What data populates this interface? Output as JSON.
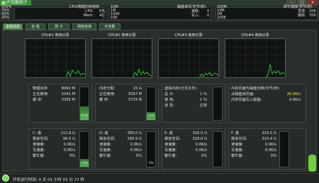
{
  "window": {
    "title": "IP流量统计",
    "buttons": [
      "–",
      "□",
      "×"
    ]
  },
  "top_meters": {
    "left_scale": [
      "100%",
      "75%",
      "50%",
      "25%",
      "0%"
    ],
    "cpu": {
      "title": "CPU/物理内存使用",
      "cpu_label": "CPU:",
      "cpu_value": "0%",
      "mem_label": "Mem:",
      "mem_value": "41"
    },
    "disk": {
      "scale": [
        "10M",
        "1M",
        "100K",
        "10K",
        "1K"
      ],
      "title": "磁盘读写(字节/秒)",
      "read_label": "读取:",
      "read_value": "0",
      "write_label": "写入:",
      "write_value": "0"
    },
    "net": {
      "scale": [
        "100M",
        "10M",
        "1M",
        "100K"
      ],
      "title": "网卡速度(字节/秒)",
      "send_label": "发送:",
      "send_value": "106",
      "recv_label": "接收:",
      "recv_value": "700"
    }
  },
  "tabs": [
    "系统状态",
    "进 程",
    "网 卡",
    "网络连接",
    "IP流量"
  ],
  "cpu_charts": [
    {
      "title": "CPU#1 使用记录",
      "values": [
        0,
        0,
        0,
        0,
        0,
        0,
        0,
        0,
        0,
        0,
        0,
        0,
        0,
        0,
        0,
        0,
        0,
        0,
        0,
        1,
        3,
        18,
        6,
        22,
        15,
        13,
        20,
        9,
        14,
        12,
        10
      ]
    },
    {
      "title": "CPU#2 使用记录",
      "values": [
        0,
        0,
        0,
        0,
        0,
        0,
        0,
        0,
        0,
        0,
        0,
        0,
        0,
        0,
        0,
        0,
        0,
        0,
        0,
        1,
        2,
        16,
        8,
        24,
        11,
        18,
        12,
        16,
        10,
        8,
        6
      ]
    },
    {
      "title": "CPU#3 使用记录",
      "values": [
        0,
        0,
        0,
        0,
        0,
        0,
        0,
        0,
        0,
        0,
        0,
        0,
        0,
        0,
        0,
        0,
        0,
        0,
        0,
        1,
        2,
        12,
        5,
        14,
        10,
        16,
        8,
        12,
        14,
        9,
        7
      ]
    },
    {
      "title": "CPU#4 使用记录",
      "values": [
        0,
        0,
        0,
        0,
        0,
        0,
        0,
        0,
        0,
        0,
        0,
        0,
        0,
        0,
        0,
        0,
        0,
        0,
        0,
        1,
        4,
        10,
        36,
        12,
        18,
        14,
        20,
        11,
        16,
        13,
        10
      ]
    }
  ],
  "memory": {
    "physical": {
      "rows": [
        [
          "物理内存:",
          "8060 M"
        ],
        [
          "正在使用:",
          "3341 M"
        ],
        [
          "缓 存:",
          "3356 M"
        ]
      ],
      "percent": 41,
      "percent_label": "41%"
    },
    "commit": {
      "rows": [
        [
          "内存分配:",
          "15 G"
        ],
        [
          "正在使用:",
          "3597 M"
        ],
        [
          "缓 存:",
          "3734 M"
        ]
      ],
      "percent": 23,
      "percent_label": "23%"
    },
    "virtual": {
      "rows": [
        [
          "虚拟内存(分页文件):",
          ""
        ],
        [
          "总 计:",
          "1 %"
        ],
        [
          "使 用:",
          "1 %"
        ],
        [
          "状 态:",
          "正常"
        ]
      ],
      "percent": 1,
      "percent_label": ""
    },
    "paging": {
      "rows": [
        [
          "内存页面与磁盘交换(字节/秒)",
          ""
        ],
        [
          "从磁盘读页面:",
          "26.0K/s"
        ],
        [
          "内存页面写入磁盘:",
          "0.0K/s"
        ]
      ]
    }
  },
  "disks": [
    {
      "name": "C: 盘",
      "total": "111.8 G",
      "rows": [
        [
          "剩余空间:",
          "96.0 G"
        ],
        [
          "读速度:",
          "0.0K/s"
        ],
        [
          "写速度:",
          "0.0K/s"
        ],
        [
          "繁忙度:",
          "0%"
        ]
      ],
      "percent": 23,
      "percent_label": "23%"
    },
    {
      "name": "D: 盘",
      "total": "300.0 G",
      "rows": [
        [
          "剩余空间:",
          "295.9 G"
        ],
        [
          "读速度:",
          "0.0K/s"
        ],
        [
          "写速度:",
          "0.0K/s"
        ],
        [
          "繁忙度:",
          "0%"
        ]
      ],
      "percent": 1,
      "percent_label": "1%"
    },
    {
      "name": "E: 盘",
      "total": "316.0 G",
      "rows": [
        [
          "剩余空间:",
          "316.0 G"
        ],
        [
          "读速度:",
          "0.0K/s"
        ],
        [
          "写速度:",
          "0.0K/s"
        ],
        [
          "繁忙度:",
          "0%"
        ]
      ],
      "percent": 0,
      "percent_label": ""
    },
    {
      "name": "F: 盘",
      "total": "315.5 G",
      "rows": [
        [
          "剩余空间:",
          "315.4 G"
        ],
        [
          "读速度:",
          "0.0K/s"
        ],
        [
          "写速度:",
          "0.0K/s"
        ],
        [
          "繁忙度:",
          "0%"
        ]
      ],
      "percent": 0,
      "percent_label": ""
    }
  ],
  "status": {
    "uptime": "开机运行时间:  0 天  01 小时  03 分  27 秒"
  },
  "colors": {
    "accent": "#4f8f4f",
    "graph_line": "#3be03b",
    "highlight": "#f2e24a"
  }
}
